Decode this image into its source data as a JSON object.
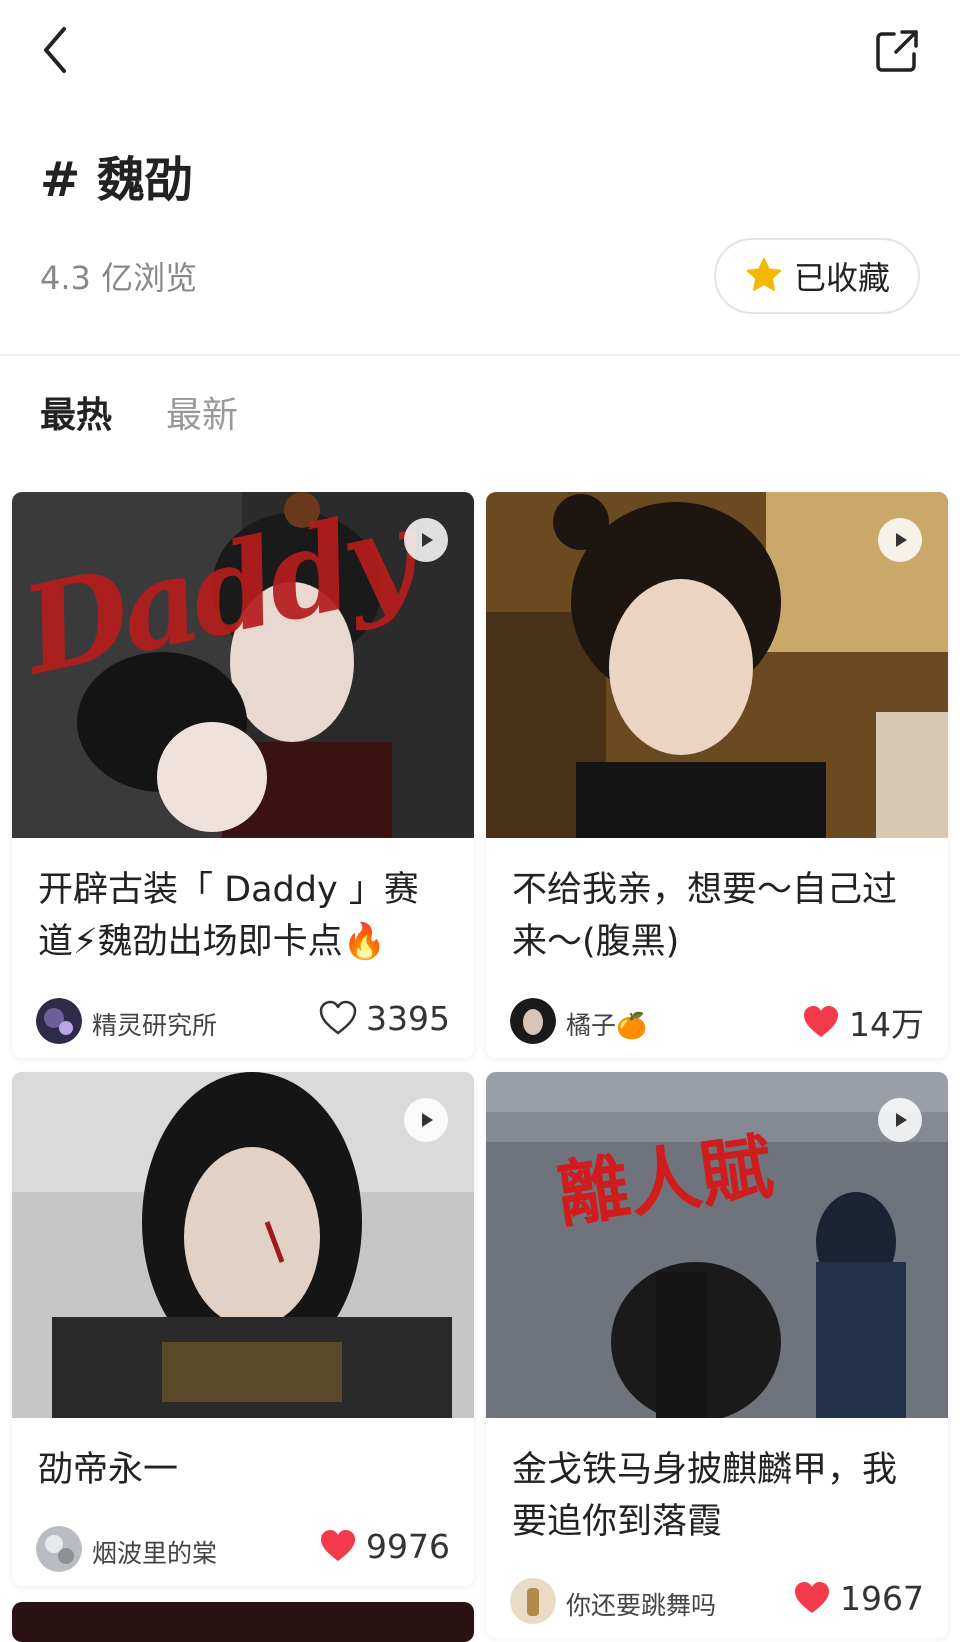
{
  "header": {
    "back_icon": "chevron-left-icon",
    "share_icon": "share-external-icon"
  },
  "topic": {
    "title": "# 魏劭",
    "views": "4.3 亿浏览",
    "favorite_label": "已收藏",
    "favorite_icon": "star-icon",
    "star_color": "#f5b800"
  },
  "tabs": [
    {
      "label": "最热",
      "active": true
    },
    {
      "label": "最新",
      "active": false
    }
  ],
  "cards": [
    {
      "title": "开辟古装「 Daddy 」赛道⚡魏劭出场即卡点🔥",
      "author": "精灵研究所",
      "likes": "3395",
      "liked": false,
      "overlay_text": "Daddy",
      "play_icon": "play-icon"
    },
    {
      "title": "不给我亲，想要～自己过来～(腹黑)",
      "author": "橘子🍊",
      "likes": "14万",
      "liked": true,
      "play_icon": "play-icon"
    },
    {
      "title": "劭帝永一",
      "author": "烟波里的棠",
      "likes": "9976",
      "liked": true,
      "play_icon": "play-icon"
    },
    {
      "title": "金戈铁马身披麒麟甲，我要追你到落霞",
      "author": "你还要跳舞吗",
      "likes": "1967",
      "liked": true,
      "overlay_text": "離人賦",
      "play_icon": "play-icon"
    }
  ],
  "colors": {
    "heart_red": "#f23a4a",
    "text_dark": "#222222",
    "text_muted": "#888888"
  }
}
